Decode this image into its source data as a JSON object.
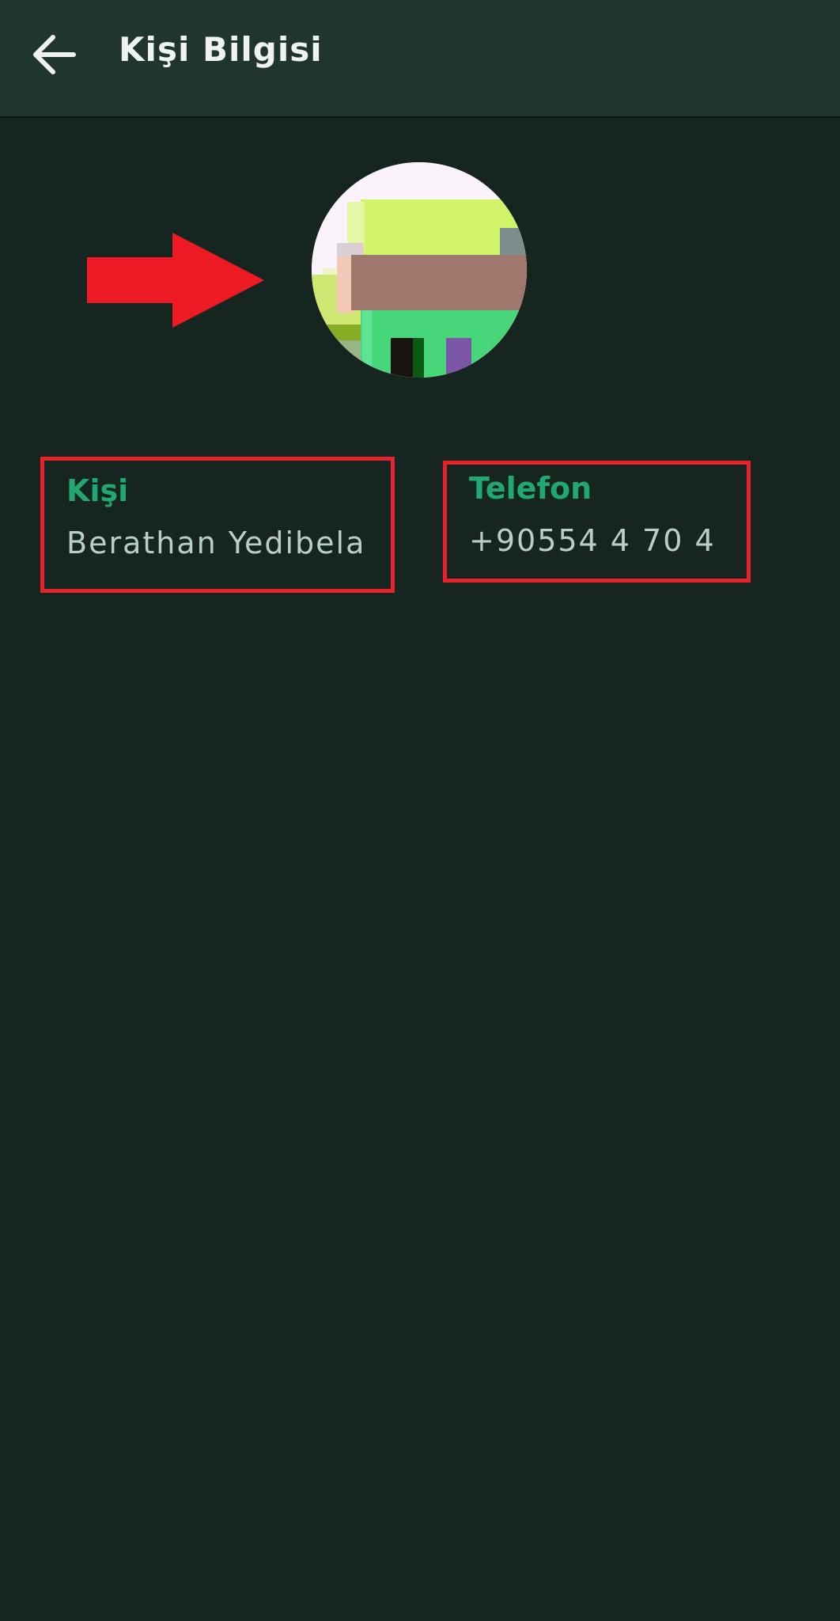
{
  "app_bar": {
    "title": "Kişi Bilgisi",
    "back_icon": "arrow-left-icon"
  },
  "annotation": {
    "arrow_icon": "red-arrow-right",
    "color": "#ed1c24"
  },
  "profile": {
    "avatar_icon": "contact-photo"
  },
  "contact_field": {
    "label": "Kişi",
    "value": "Berathan Yedibela"
  },
  "phone_field": {
    "label": "Telefon",
    "value": "+90554 4 70 4"
  },
  "colors": {
    "background": "#172520",
    "app_bar": "#1f352d",
    "accent": "#21a872",
    "highlight_box": "#e8222a"
  }
}
